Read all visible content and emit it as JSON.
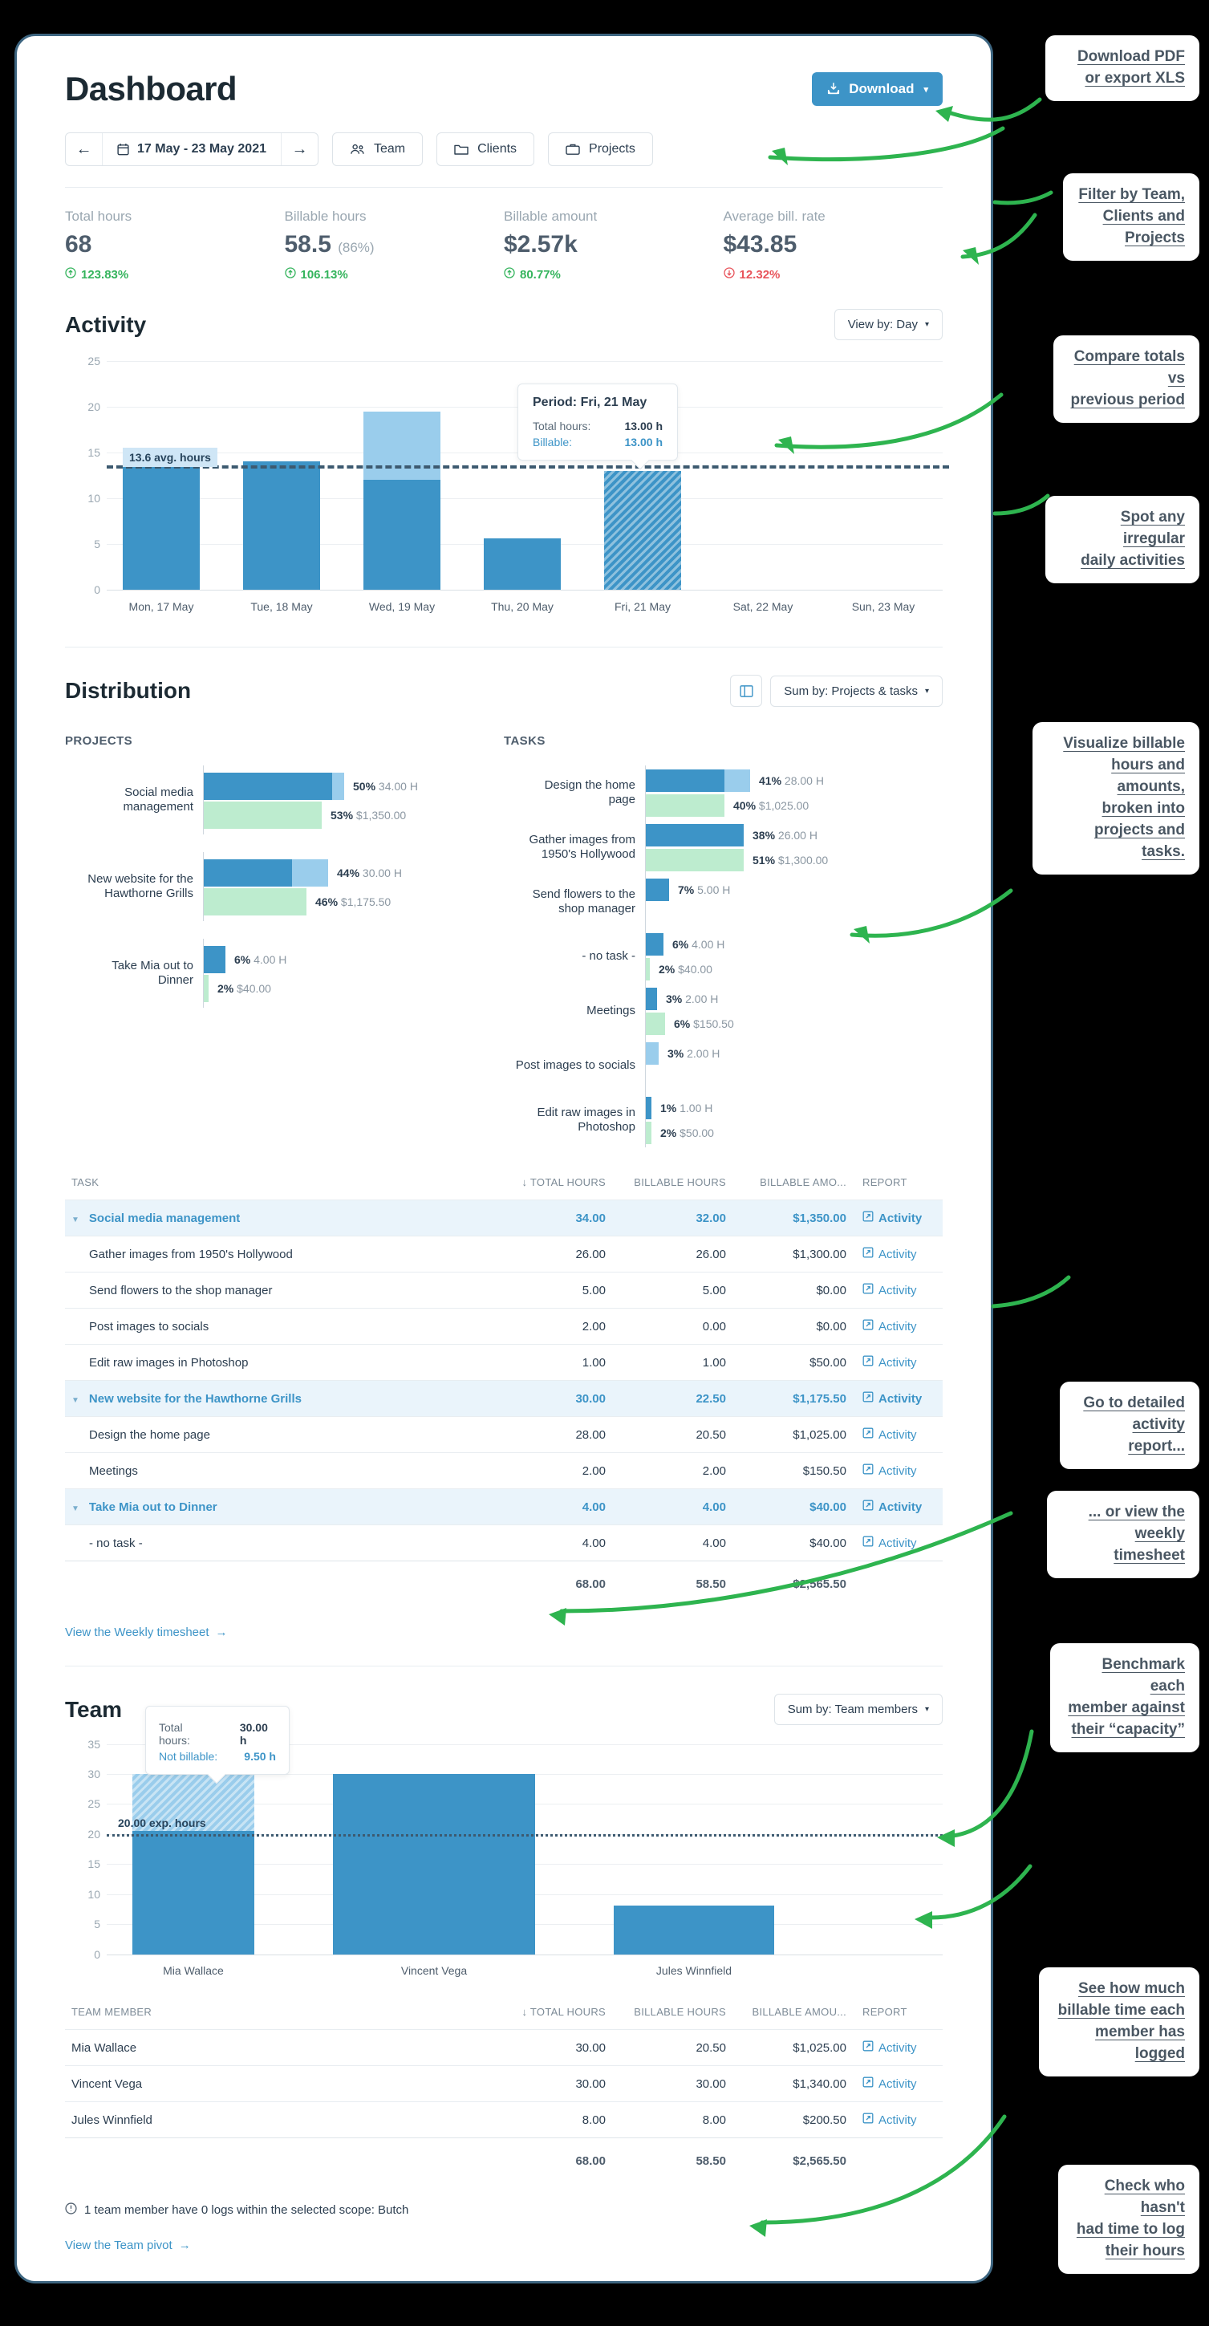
{
  "header": {
    "title": "Dashboard",
    "download_label": "Download",
    "download_caret": "▾"
  },
  "filters": {
    "prev_label": "←",
    "next_label": "→",
    "date_range": "17 May - 23 May 2021",
    "team_label": "Team",
    "clients_label": "Clients",
    "projects_label": "Projects"
  },
  "stats": [
    {
      "label": "Total hours",
      "value": "68",
      "sub": "",
      "delta": "123.83%",
      "dir": "up"
    },
    {
      "label": "Billable hours",
      "value": "58.5",
      "sub": "(86%)",
      "delta": "106.13%",
      "dir": "up"
    },
    {
      "label": "Billable amount",
      "value": "$2.57k",
      "sub": "",
      "delta": "80.77%",
      "dir": "up"
    },
    {
      "label": "Average bill. rate",
      "value": "$43.85",
      "sub": "",
      "delta": "12.32%",
      "dir": "down"
    }
  ],
  "activity": {
    "title": "Activity",
    "view_by_label": "View by: Day",
    "tooltip": {
      "title": "Period: Fri, 21 May",
      "rows": [
        {
          "key": "Total hours:",
          "value": "13.00 h"
        },
        {
          "key": "Billable:",
          "value": "13.00 h"
        }
      ]
    },
    "avg_badge": "13.6 avg. hours"
  },
  "distribution": {
    "title": "Distribution",
    "sum_by_label": "Sum by: Projects & tasks",
    "projects_caption": "PROJECTS",
    "tasks_caption": "TASKS"
  },
  "tasks_table": {
    "columns": [
      "TASK",
      "↓ TOTAL HOURS",
      "BILLABLE HOURS",
      "BILLABLE AMO...",
      "REPORT"
    ],
    "rows": [
      {
        "type": "group",
        "name": "Social media management",
        "total": "34.00",
        "billable": "32.00",
        "amount": "$1,350.00",
        "report": "Activity"
      },
      {
        "type": "child",
        "name": "Gather images from 1950's Hollywood",
        "total": "26.00",
        "billable": "26.00",
        "amount": "$1,300.00",
        "report": "Activity"
      },
      {
        "type": "child",
        "name": "Send flowers to the shop manager",
        "total": "5.00",
        "billable": "5.00",
        "amount": "$0.00",
        "report": "Activity"
      },
      {
        "type": "child",
        "name": "Post images to socials",
        "total": "2.00",
        "billable": "0.00",
        "amount": "$0.00",
        "report": "Activity"
      },
      {
        "type": "child",
        "name": "Edit raw images in Photoshop",
        "total": "1.00",
        "billable": "1.00",
        "amount": "$50.00",
        "report": "Activity"
      },
      {
        "type": "group",
        "name": "New website for the Hawthorne Grills",
        "total": "30.00",
        "billable": "22.50",
        "amount": "$1,175.50",
        "report": "Activity"
      },
      {
        "type": "child",
        "name": "Design the home page",
        "total": "28.00",
        "billable": "20.50",
        "amount": "$1,025.00",
        "report": "Activity"
      },
      {
        "type": "child",
        "name": "Meetings",
        "total": "2.00",
        "billable": "2.00",
        "amount": "$150.50",
        "report": "Activity"
      },
      {
        "type": "group",
        "name": "Take Mia out to Dinner",
        "total": "4.00",
        "billable": "4.00",
        "amount": "$40.00",
        "report": "Activity"
      },
      {
        "type": "child",
        "name": "- no task -",
        "total": "4.00",
        "billable": "4.00",
        "amount": "$40.00",
        "report": "Activity"
      }
    ],
    "totals": {
      "total": "68.00",
      "billable": "58.50",
      "amount": "$2,565.50"
    },
    "footer_link": "View the Weekly timesheet"
  },
  "team": {
    "title": "Team",
    "sum_by_label": "Sum by: Team members",
    "tooltip": {
      "rows": [
        {
          "key": "Total hours:",
          "value": "30.00 h"
        },
        {
          "key": "Not billable:",
          "value": "9.50 h"
        }
      ]
    },
    "exp_badge": "20.00 exp. hours",
    "columns": [
      "TEAM MEMBER",
      "↓ TOTAL HOURS",
      "BILLABLE HOURS",
      "BILLABLE AMOU...",
      "REPORT"
    ],
    "rows": [
      {
        "name": "Mia Wallace",
        "total": "30.00",
        "billable": "20.50",
        "amount": "$1,025.00",
        "report": "Activity"
      },
      {
        "name": "Vincent Vega",
        "total": "30.00",
        "billable": "30.00",
        "amount": "$1,340.00",
        "report": "Activity"
      },
      {
        "name": "Jules Winnfield",
        "total": "8.00",
        "billable": "8.00",
        "amount": "$200.50",
        "report": "Activity"
      }
    ],
    "totals": {
      "total": "68.00",
      "billable": "58.50",
      "amount": "$2,565.50"
    },
    "note": "1 team member have 0 logs within the selected scope: Butch",
    "footer_link": "View the Team pivot"
  },
  "callouts": [
    {
      "id": "download",
      "text": "Download PDF\nor export XLS"
    },
    {
      "id": "filter",
      "text": "Filter by Team,\nClients and\nProjects"
    },
    {
      "id": "compare",
      "text": "Compare totals vs\nprevious period"
    },
    {
      "id": "irregular",
      "text": "Spot any irregular\ndaily activities"
    },
    {
      "id": "visualize",
      "text": "Visualize billable\nhours and amounts,\nbroken into\nprojects and tasks."
    },
    {
      "id": "detailed",
      "text": "Go to detailed\nactivity report..."
    },
    {
      "id": "weekly",
      "text": "... or view the\nweekly timesheet"
    },
    {
      "id": "benchmark",
      "text": "Benchmark each\nmember against\ntheir “capacity”"
    },
    {
      "id": "billable",
      "text": "See how much\nbillable time each\nmember has logged"
    },
    {
      "id": "checkwho",
      "text": "Check who hasn't\nhad time to log\ntheir hours"
    }
  ],
  "colors": {
    "accent": "#3d94c7",
    "accent_light": "#9acdec",
    "green_bar": "#bdeccf",
    "up": "#35b45d",
    "down": "#e8545b",
    "arrow": "#2eb44f",
    "card_border": "#3d6580"
  },
  "chart_data": [
    {
      "type": "bar",
      "name": "activity-daily-hours",
      "title": "Activity",
      "xlabel": "",
      "ylabel": "",
      "ylim": [
        0,
        25
      ],
      "yticks": [
        0,
        5,
        10,
        15,
        20,
        25
      ],
      "grid": true,
      "categories": [
        "Mon, 17 May",
        "Tue, 18 May",
        "Wed, 19 May",
        "Thu, 20 May",
        "Fri, 21 May",
        "Sat, 22 May",
        "Sun, 23 May"
      ],
      "series": [
        {
          "name": "Billable hours",
          "values": [
            14.0,
            14.0,
            12.0,
            5.6,
            13.0,
            0,
            0
          ]
        },
        {
          "name": "Non-billable hours",
          "values": [
            0,
            0,
            7.5,
            0,
            0,
            0,
            0
          ]
        }
      ],
      "reference_line": {
        "label": "13.6 avg. hours",
        "value": 13.6
      }
    },
    {
      "type": "bar",
      "name": "distribution-projects",
      "title": "PROJECTS",
      "orientation": "horizontal",
      "categories": [
        "Social media management",
        "New website for the Hawthorne Grills",
        "Take Mia out to Dinner"
      ],
      "series": [
        {
          "name": "Hours",
          "percents": [
            50,
            44,
            6
          ],
          "values": [
            "34.00 H",
            "30.00 H",
            "4.00 H"
          ]
        },
        {
          "name": "Amount",
          "percents": [
            53,
            46,
            2
          ],
          "values": [
            "$1,350.00",
            "$1,175.50",
            "$40.00"
          ]
        }
      ]
    },
    {
      "type": "bar",
      "name": "distribution-tasks",
      "title": "TASKS",
      "orientation": "horizontal",
      "categories": [
        "Design the home page",
        "Gather images from 1950's Hollywood",
        "Send flowers to the shop manager",
        "- no task -",
        "Meetings",
        "Post images to socials",
        "Edit raw images in Photoshop"
      ],
      "series": [
        {
          "name": "Hours",
          "percents": [
            41,
            38,
            7,
            6,
            3,
            3,
            1
          ],
          "values": [
            "28.00 H",
            "26.00 H",
            "5.00 H",
            "4.00 H",
            "2.00 H",
            "2.00 H",
            "1.00 H"
          ]
        },
        {
          "name": "Amount",
          "percents": [
            40,
            51,
            null,
            2,
            6,
            null,
            2
          ],
          "values": [
            "$1,025.00",
            "$1,300.00",
            null,
            "$40.00",
            "$150.50",
            null,
            "$50.00"
          ]
        }
      ]
    },
    {
      "type": "bar",
      "name": "team-member-hours",
      "title": "Team",
      "ylim": [
        0,
        35
      ],
      "yticks": [
        0,
        5,
        10,
        15,
        20,
        25,
        30,
        35
      ],
      "grid": true,
      "categories": [
        "Mia Wallace",
        "Vincent Vega",
        "Jules Winnfield"
      ],
      "series": [
        {
          "name": "Billable hours",
          "values": [
            20.5,
            30.0,
            8.1
          ]
        },
        {
          "name": "Non-billable hours",
          "values": [
            9.5,
            0,
            0
          ]
        }
      ],
      "reference_line": {
        "label": "20.00 exp. hours",
        "value": 20.0
      }
    }
  ]
}
